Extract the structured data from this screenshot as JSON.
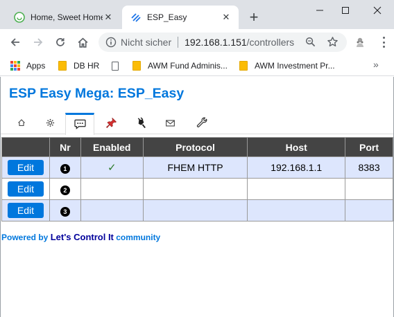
{
  "browser": {
    "tabs": [
      {
        "title": "Home, Sweet Home",
        "active": false,
        "favicon": "home-assistant-favicon"
      },
      {
        "title": "ESP_Easy",
        "active": true,
        "favicon": "esp-easy-favicon"
      }
    ],
    "security_label": "Nicht sicher",
    "url_host": "192.168.1.151",
    "url_path": "/controllers",
    "bookmarks": [
      {
        "label": "Apps",
        "icon": "apps-grid-icon"
      },
      {
        "label": "DB HR",
        "icon": "folder-icon"
      },
      {
        "label": "",
        "icon": "page-icon"
      },
      {
        "label": "AWM Fund Adminis...",
        "icon": "folder-icon"
      },
      {
        "label": "AWM Investment Pr...",
        "icon": "folder-icon"
      }
    ],
    "bookmarks_more": "»"
  },
  "page": {
    "title": "ESP Easy Mega: ESP_Easy",
    "menu": [
      {
        "name": "main",
        "icon": "home-icon"
      },
      {
        "name": "config",
        "icon": "gear-icon"
      },
      {
        "name": "controllers",
        "icon": "speech-bubble-icon",
        "active": true
      },
      {
        "name": "hardware",
        "icon": "pushpin-icon"
      },
      {
        "name": "devices",
        "icon": "plug-icon"
      },
      {
        "name": "notifications",
        "icon": "envelope-icon"
      },
      {
        "name": "tools",
        "icon": "wrench-icon"
      }
    ],
    "table": {
      "headers": [
        "",
        "Nr",
        "Enabled",
        "Protocol",
        "Host",
        "Port"
      ],
      "rows": [
        {
          "edit": "Edit",
          "nr": "1",
          "enabled": "✓",
          "protocol": "FHEM HTTP",
          "host": "192.168.1.1",
          "port": "8383"
        },
        {
          "edit": "Edit",
          "nr": "2",
          "enabled": "",
          "protocol": "",
          "host": "",
          "port": ""
        },
        {
          "edit": "Edit",
          "nr": "3",
          "enabled": "",
          "protocol": "",
          "host": "",
          "port": ""
        }
      ]
    },
    "footer": {
      "prefix": "Powered by ",
      "link": "Let's Control It",
      "suffix": " community"
    }
  },
  "colors": {
    "accent": "#0077dd",
    "header_bg": "#444444",
    "row_highlight": "#dde6fd",
    "footer_link": "#00009b"
  }
}
